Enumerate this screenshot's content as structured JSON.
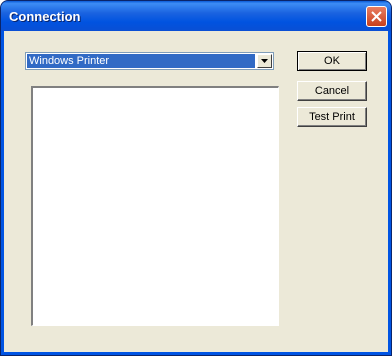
{
  "window": {
    "title": "Connection"
  },
  "printer_select": {
    "value": "Windows Printer"
  },
  "buttons": {
    "ok": "OK",
    "cancel": "Cancel",
    "test_print": "Test Print"
  },
  "icons": {
    "close": "close-icon",
    "dropdown": "chevron-down-icon"
  },
  "colors": {
    "title_bar": "#0054e3",
    "dialog_background": "#ece9d8",
    "selection": "#316ac5",
    "close_button": "#d4502c"
  }
}
